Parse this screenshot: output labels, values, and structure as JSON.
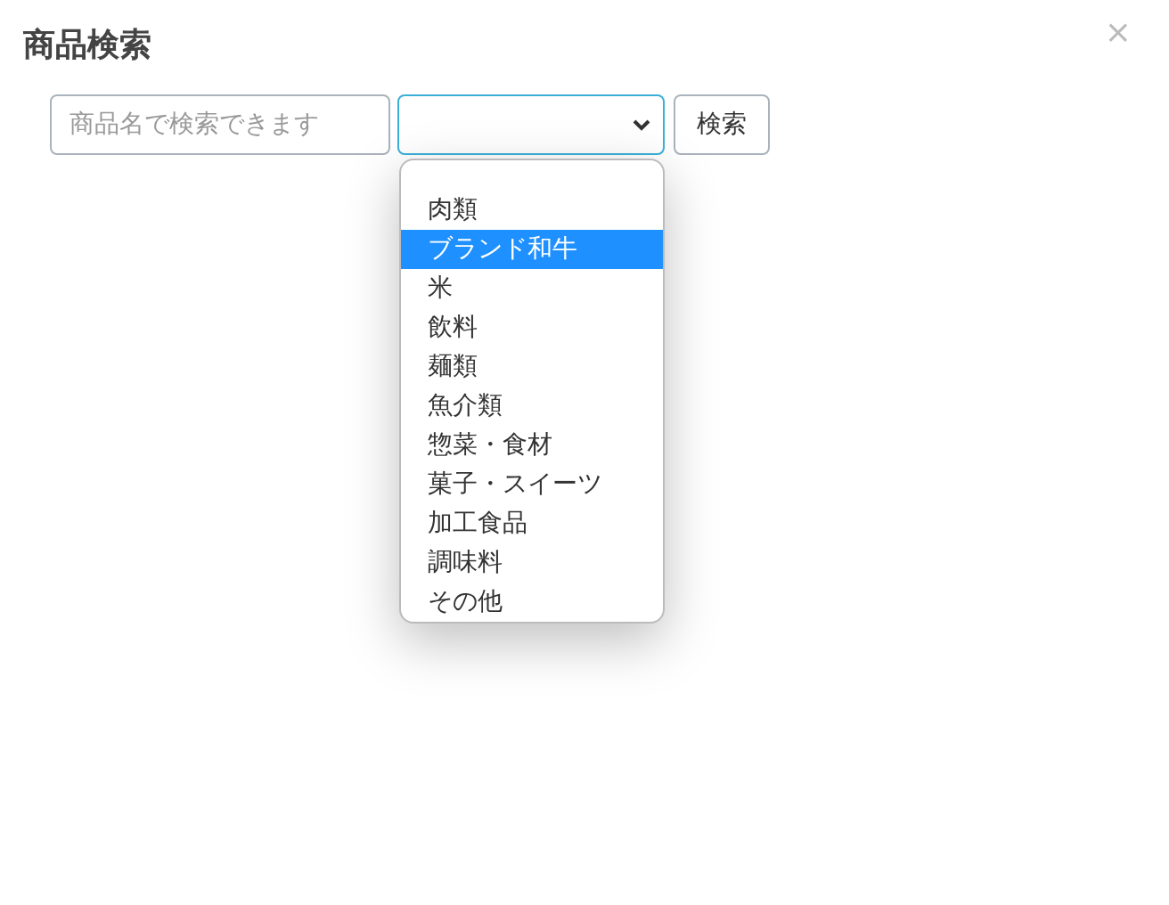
{
  "dialog": {
    "title": "商品検索",
    "close": "×"
  },
  "search": {
    "placeholder": "商品名で検索できます"
  },
  "category_select": {
    "expanded": true
  },
  "category_options": [
    {
      "label": "肉類",
      "selected": false
    },
    {
      "label": "ブランド和牛",
      "selected": true
    },
    {
      "label": "米",
      "selected": false
    },
    {
      "label": "飲料",
      "selected": false
    },
    {
      "label": "麺類",
      "selected": false
    },
    {
      "label": "魚介類",
      "selected": false
    },
    {
      "label": "惣菜・食材",
      "selected": false
    },
    {
      "label": "菓子・スイーツ",
      "selected": false
    },
    {
      "label": "加工食品",
      "selected": false
    },
    {
      "label": "調味料",
      "selected": false
    },
    {
      "label": "その他",
      "selected": false
    }
  ],
  "search_button": "検索"
}
